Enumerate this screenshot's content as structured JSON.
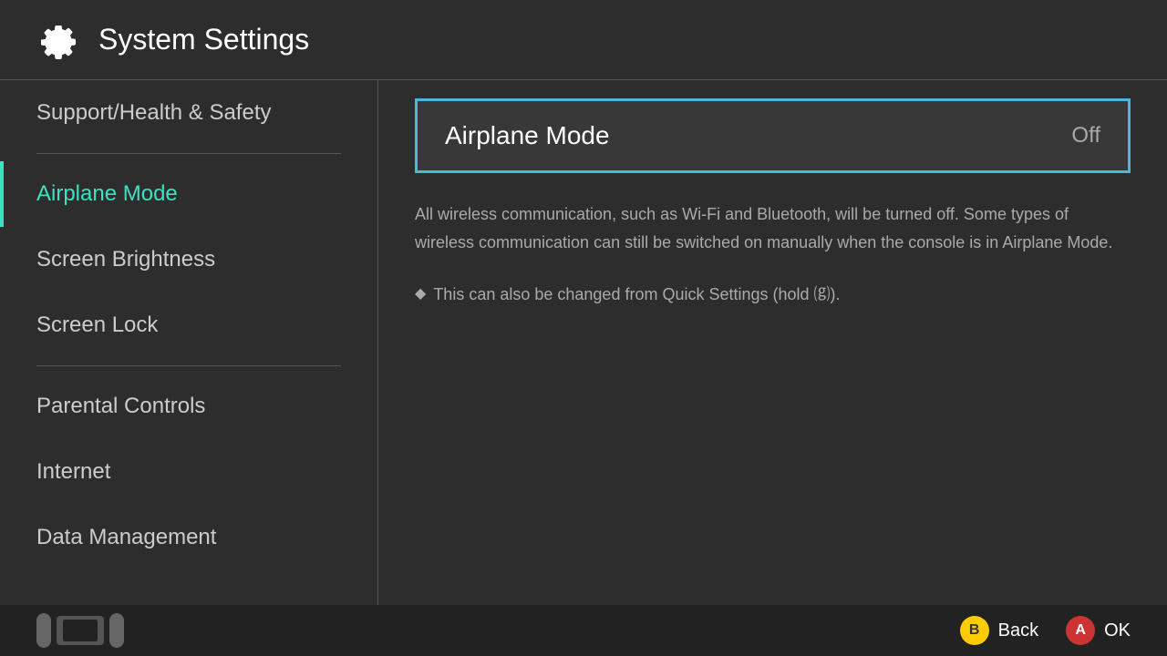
{
  "header": {
    "title": "System Settings",
    "icon": "gear"
  },
  "sidebar": {
    "items": [
      {
        "id": "support",
        "label": "Support/Health & Safety",
        "active": false,
        "divider_after": true
      },
      {
        "id": "airplane",
        "label": "Airplane Mode",
        "active": true,
        "divider_after": false
      },
      {
        "id": "brightness",
        "label": "Screen Brightness",
        "active": false,
        "divider_after": false
      },
      {
        "id": "screenlock",
        "label": "Screen Lock",
        "active": false,
        "divider_after": true
      },
      {
        "id": "parental",
        "label": "Parental Controls",
        "active": false,
        "divider_after": false
      },
      {
        "id": "internet",
        "label": "Internet",
        "active": false,
        "divider_after": false
      },
      {
        "id": "datamanagement",
        "label": "Data Management",
        "active": false,
        "divider_after": false
      }
    ]
  },
  "content": {
    "selected_title": "Airplane Mode",
    "selected_value": "Off",
    "description": "All wireless communication, such as Wi-Fi and Bluetooth, will be turned off. Some types of wireless communication can still be switched on manually when the console is in Airplane Mode.",
    "tip": "This can also be changed from Quick Settings (hold ⒢)."
  },
  "footer": {
    "back_label": "Back",
    "ok_label": "OK",
    "b_button": "B",
    "a_button": "A"
  }
}
